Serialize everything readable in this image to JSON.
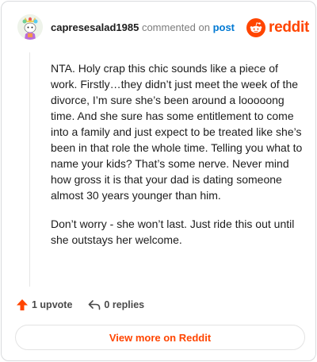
{
  "header": {
    "username": "capresesalad1985",
    "action_text": "commented on",
    "post_link": "post",
    "brand": "reddit"
  },
  "comment": {
    "paragraphs": [
      "NTA. Holy crap this chic sounds like a piece of work. Firstly…they didn’t just meet the week of the divorce, I’m sure she’s been around a looooong time. And she sure has some entitlement to come into a family and just expect to be treated like she’s been in that role the whole time. Telling you what to name your kids? That’s some nerve. Never mind how gross it is that your dad is dating someone almost 30 years younger than him.",
      "Don’t worry - she won’t last. Just ride this out until she outstays her welcome."
    ]
  },
  "actions": {
    "upvote_label": "1 upvote",
    "replies_label": "0 replies"
  },
  "footer": {
    "view_more_label": "View more on Reddit"
  },
  "colors": {
    "brand": "#ff4500",
    "link": "#0079d3"
  }
}
